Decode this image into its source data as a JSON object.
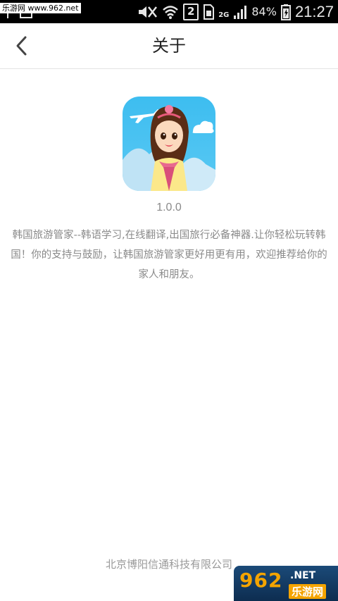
{
  "status_bar": {
    "watermark": "乐游网 www.962.net",
    "sim_slot": "2",
    "network_type": "2G",
    "battery_percent": "84%",
    "time": "21:27"
  },
  "header": {
    "title": "关于"
  },
  "app": {
    "icon": "app-icon-girl-hanbok",
    "version": "1.0.0",
    "description": "韩国旅游管家--韩语学习,在线翻译,出国旅行必备神器.让你轻松玩转韩国！你的支持与鼓励，让韩国旅游管家更好用更有用，欢迎推荐给你的家人和朋友。"
  },
  "footer": {
    "company": "北京博阳信通科技有限公司"
  },
  "watermark_corner": {
    "number": "962",
    "net": ".NET",
    "site_name": "乐游网"
  },
  "colors": {
    "status_bar_bg": "#000000",
    "icon_sky": "#4fc2ef",
    "text_gray": "#8a8a8a"
  }
}
